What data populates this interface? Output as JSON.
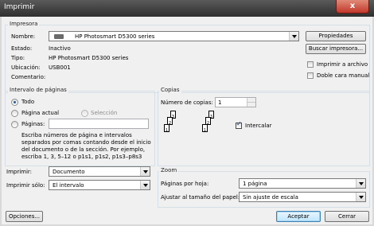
{
  "window": {
    "title": "Imprimir",
    "close": "x"
  },
  "printer": {
    "group": "Impresora",
    "name_label": "Nombre:",
    "name_value": "HP Photosmart D5300 series",
    "status_label": "Estado:",
    "status_value": "Inactivo",
    "type_label": "Tipo:",
    "type_value": "HP Photosmart D5300 series",
    "location_label": "Ubicación:",
    "location_value": "USB001",
    "comment_label": "Comentario:",
    "properties_button": "Propiedades",
    "find_button": "Buscar impresora...",
    "print_to_file": "Imprimir a archivo",
    "duplex": "Doble cara manual"
  },
  "range": {
    "group": "Intervalo de páginas",
    "all": "Todo",
    "current": "Página actual",
    "selection": "Selección",
    "pages": "Páginas:",
    "help": [
      "Escriba números de página e intervalos",
      "separados por comas contando desde el inicio",
      "del documento o de la sección. Por ejemplo,",
      "escriba 1, 3, 5–12 o p1s1, p1s2, p1s3–p8s3"
    ]
  },
  "copies": {
    "group": "Copias",
    "count_label": "Número de copias:",
    "count_value": "1",
    "collate": "Intercalar",
    "sheet_numbers": [
      "3",
      "2",
      "1",
      "3",
      "2",
      "1"
    ]
  },
  "print_what": {
    "label": "Imprimir:",
    "value": "Documento"
  },
  "print_only": {
    "label": "Imprimir sólo:",
    "value": "El intervalo"
  },
  "zoom": {
    "group": "Zoom",
    "pages_label": "Páginas por hoja:",
    "pages_value": "1 página",
    "scale_label": "Ajustar al tamaño del papel:",
    "scale_value": "Sin ajuste de escala"
  },
  "footer": {
    "options": "Opciones...",
    "ok": "Aceptar",
    "cancel": "Cerrar"
  }
}
